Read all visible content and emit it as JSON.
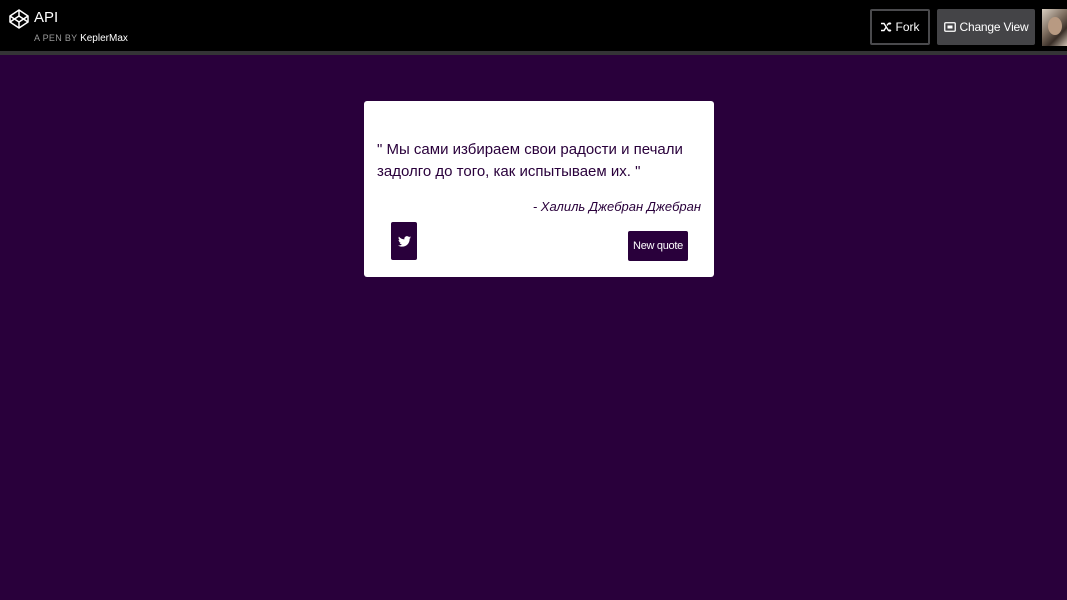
{
  "header": {
    "title": "API",
    "pen_by_label": "A PEN BY",
    "author": "KeplerMax",
    "fork_label": "Fork",
    "change_view_label": "Change View"
  },
  "quote": {
    "text": "\" Мы сами избираем свои радости и печали задолго до того, как испытываем их. \"",
    "author": "- Халиль Джебран Джебран"
  },
  "buttons": {
    "new_quote_label": "New quote"
  },
  "icons": {
    "logo": "codepen-logo-icon",
    "fork": "fork-icon",
    "change_view": "change-view-icon",
    "tweet": "twitter-icon"
  },
  "colors": {
    "background": "#29003b",
    "topbar": "#000000",
    "card": "#ffffff",
    "button": "#29003b",
    "change_view_bg": "#444447"
  }
}
